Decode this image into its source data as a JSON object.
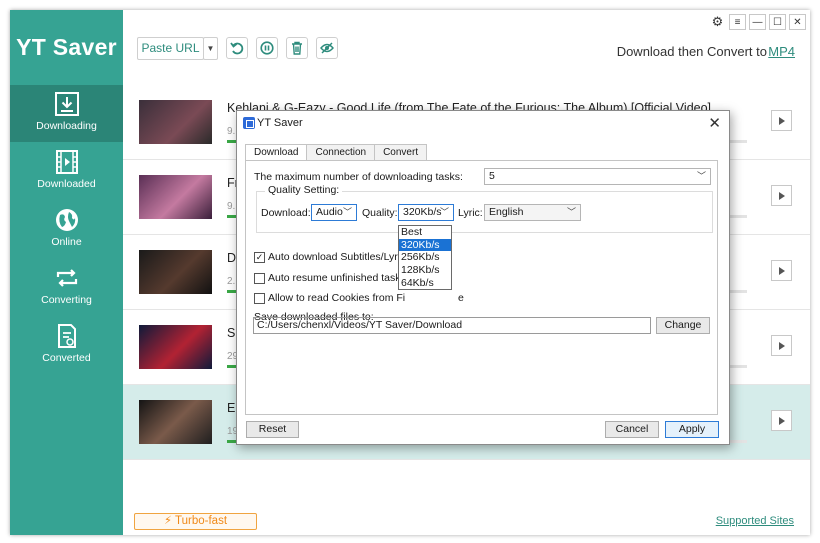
{
  "app": {
    "title": "YT Saver"
  },
  "sidebar": {
    "items": [
      {
        "label": "Downloading",
        "icon": "download-icon",
        "active": true
      },
      {
        "label": "Downloaded",
        "icon": "film-icon"
      },
      {
        "label": "Online",
        "icon": "globe-icon"
      },
      {
        "label": "Converting",
        "icon": "convert-icon"
      },
      {
        "label": "Converted",
        "icon": "converted-file-icon"
      }
    ]
  },
  "toolbar": {
    "paste_label": "Paste URL",
    "convert_text": "Download then Convert to",
    "convert_format": "MP4"
  },
  "rows": [
    {
      "title": "Kehlani & G-Eazy - Good Life (from The Fate of the Furious: The Album) [Official Video]",
      "meta": "9.",
      "colors": [
        "#3a2f3a",
        "#7a4a55"
      ]
    },
    {
      "title": "Fr",
      "meta": "9.",
      "colors": [
        "#5a2f55",
        "#c47aa0"
      ]
    },
    {
      "title": "D",
      "meta": "2.",
      "colors": [
        "#1a1a1a",
        "#553a2e"
      ]
    },
    {
      "title": "Sl",
      "meta": "29",
      "colors": [
        "#0f1a3a",
        "#b22233"
      ]
    },
    {
      "title": "El",
      "meta": "19",
      "colors": [
        "#141414",
        "#7a5a4a"
      ]
    }
  ],
  "footer": {
    "turbo": "⚡ Turbo-fast",
    "supported": "Supported Sites"
  },
  "dialog": {
    "title": "YT Saver",
    "tabs": [
      "Download",
      "Connection",
      "Convert"
    ],
    "max_tasks_label": "The maximum number of downloading tasks:",
    "max_tasks_value": "5",
    "quality_group": "Quality Setting:",
    "download_label": "Download:",
    "download_value": "Audio",
    "quality_label": "Quality:",
    "quality_value": "320Kb/s",
    "lyric_label": "Lyric:",
    "lyric_value": "English",
    "auto_subtitles": "Auto download Subtitles/Lyric",
    "auto_resume": "Auto resume unfinished tasks",
    "allow_cookies_a": "Allow to read Cookies from Fi",
    "allow_cookies_b": "e",
    "save_label": "Save downloaded files to:",
    "save_path": "C:/Users/chenxl/Videos/YT Saver/Download",
    "change_button": "Change",
    "reset_button": "Reset",
    "cancel_button": "Cancel",
    "apply_button": "Apply",
    "quality_options": [
      "Best",
      "320Kb/s",
      "256Kb/s",
      "128Kb/s",
      "64Kb/s"
    ],
    "quality_selected": "320Kb/s"
  },
  "window_controls": {
    "settings": "⚙",
    "menu": "≡",
    "minimize": "—",
    "maximize": "☐",
    "close": "✕"
  }
}
